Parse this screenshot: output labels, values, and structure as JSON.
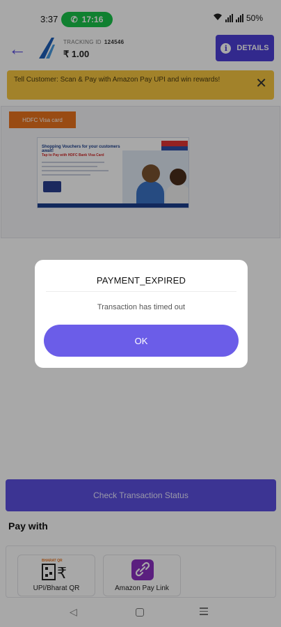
{
  "status_bar": {
    "time": "3:37",
    "call_timer": "17:16",
    "battery": "50%"
  },
  "header": {
    "tracking_label": "TRACKING ID",
    "tracking_id": "124546",
    "amount": "₹ 1.00",
    "details_label": "DETAILS"
  },
  "banner": {
    "text": "Tell Customer: Scan & Pay with Amazon Pay UPI and win rewards!"
  },
  "offer": {
    "tag": "HDFC Visa card",
    "image_headline": "Shopping Vouchers for your customers await!",
    "image_subline": "Tap to Pay with HDFC Bank Visa Card"
  },
  "actions": {
    "check_status": "Check Transaction Status"
  },
  "pay_with": {
    "heading": "Pay with",
    "options": [
      {
        "label": "UPI/Bharat QR",
        "brand": "BHARAT QR"
      },
      {
        "label": "Amazon Pay Link"
      }
    ]
  },
  "dialog": {
    "title": "PAYMENT_EXPIRED",
    "message": "Transaction has timed out",
    "ok_label": "OK"
  },
  "colors": {
    "primary": "#5b50e0",
    "banner": "#f6c640",
    "call_pill": "#19c24a",
    "tag": "#e8731e"
  }
}
